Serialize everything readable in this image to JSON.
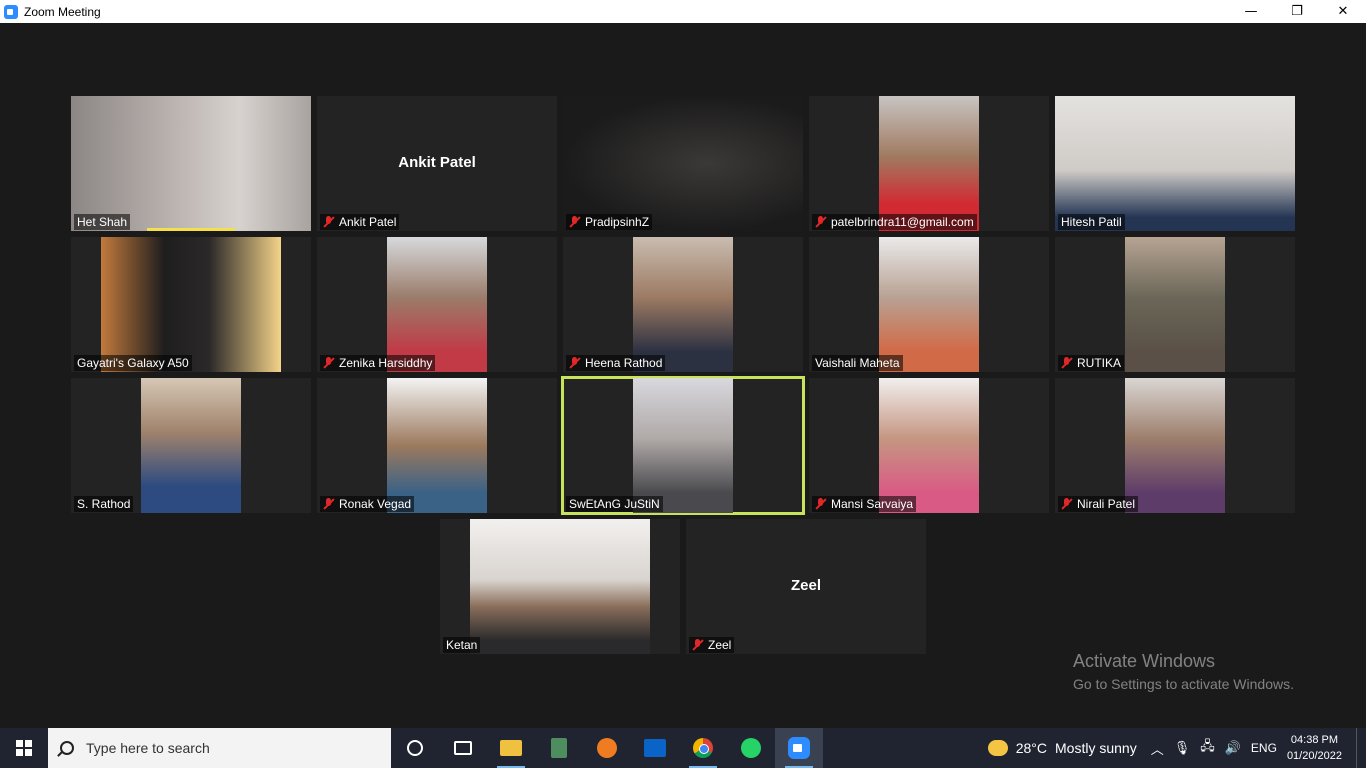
{
  "window": {
    "title": "Zoom Meeting",
    "controls": {
      "minimize": "—",
      "maximize": "❐",
      "close": "✕"
    }
  },
  "participants": [
    {
      "name": "Het Shah",
      "muted": false,
      "video": true
    },
    {
      "name": "Ankit Patel",
      "muted": true,
      "video": false
    },
    {
      "name": "PradipsinhZ",
      "muted": true,
      "video": true
    },
    {
      "name": "patelbrindra11@gmail.com",
      "muted": true,
      "video": true
    },
    {
      "name": "Hitesh Patil",
      "muted": false,
      "video": true
    },
    {
      "name": "Gayatri's Galaxy A50",
      "muted": false,
      "video": true
    },
    {
      "name": "Zenika Harsiddhy",
      "muted": true,
      "video": true
    },
    {
      "name": "Heena Rathod",
      "muted": true,
      "video": true
    },
    {
      "name": "Vaishali Maheta",
      "muted": false,
      "video": true
    },
    {
      "name": "RUTIKA",
      "muted": true,
      "video": true
    },
    {
      "name": "S. Rathod",
      "muted": false,
      "video": true
    },
    {
      "name": "Ronak Vegad",
      "muted": true,
      "video": true
    },
    {
      "name": "SwEtAnG JuStiN",
      "muted": false,
      "video": true,
      "active_speaker": true
    },
    {
      "name": "Mansi Sarvaiya",
      "muted": true,
      "video": true
    },
    {
      "name": "Nirali Patel",
      "muted": true,
      "video": true
    },
    {
      "name": "Ketan",
      "muted": false,
      "video": true
    },
    {
      "name": "Zeel",
      "muted": true,
      "video": false
    }
  ],
  "watermark": {
    "line1": "Activate Windows",
    "line2": "Go to Settings to activate Windows."
  },
  "taskbar": {
    "search_placeholder": "Type here to search",
    "weather_temp": "28°C",
    "weather_condition": "Mostly sunny",
    "language": "ENG",
    "time": "04:38 PM",
    "date": "01/20/2022",
    "apps": [
      "cortana",
      "task-view",
      "file-explorer",
      "calculator",
      "firefox",
      "outlook",
      "chrome",
      "whatsapp",
      "zoom"
    ]
  },
  "colors": {
    "active_speaker_border": "#c7e35c",
    "muted_icon": "#e02828",
    "zoom_blue": "#2d8cff"
  }
}
